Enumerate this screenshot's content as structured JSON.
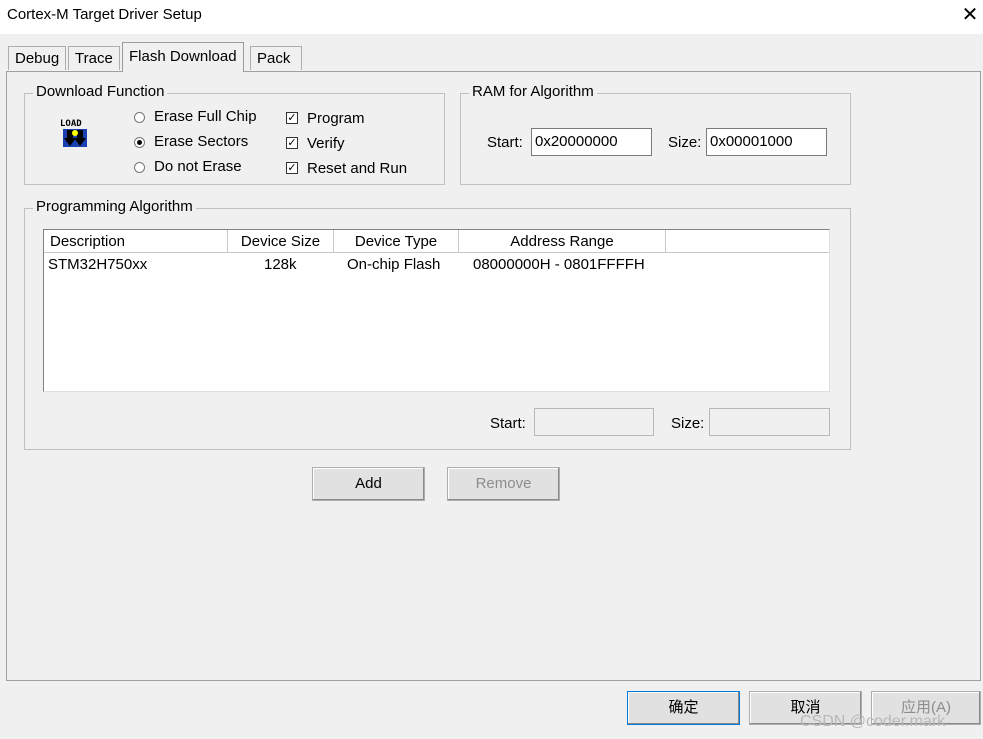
{
  "window": {
    "title": "Cortex-M Target Driver Setup"
  },
  "tabs": [
    {
      "label": "Debug"
    },
    {
      "label": "Trace"
    },
    {
      "label": "Flash Download"
    },
    {
      "label": "Pack"
    }
  ],
  "download_function": {
    "title": "Download Function",
    "icon_text": "LOAD",
    "radios": [
      {
        "label": "Erase Full Chip",
        "checked": false
      },
      {
        "label": "Erase Sectors",
        "checked": true
      },
      {
        "label": "Do not Erase",
        "checked": false
      }
    ],
    "checks": [
      {
        "label": "Program",
        "checked": true
      },
      {
        "label": "Verify",
        "checked": true
      },
      {
        "label": "Reset and Run",
        "checked": true
      }
    ]
  },
  "ram": {
    "title": "RAM for Algorithm",
    "start_label": "Start:",
    "start_value": "0x20000000",
    "size_label": "Size:",
    "size_value": "0x00001000"
  },
  "algorithm": {
    "title": "Programming Algorithm",
    "columns": [
      "Description",
      "Device Size",
      "Device Type",
      "Address Range"
    ],
    "rows": [
      {
        "description": "STM32H750xx",
        "size": "128k",
        "type": "On-chip Flash",
        "range": "08000000H - 0801FFFFH"
      }
    ],
    "start_label": "Start:",
    "start_value": "",
    "size_label": "Size:",
    "size_value": ""
  },
  "buttons": {
    "add": "Add",
    "remove": "Remove"
  },
  "footer": {
    "ok": "确定",
    "cancel": "取消",
    "apply": "应用(A)"
  },
  "watermark": "CSDN @coder.mark"
}
